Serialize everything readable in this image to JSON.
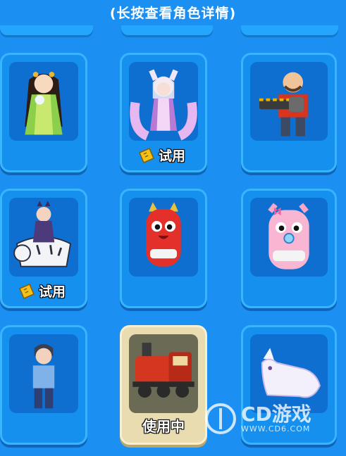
{
  "hint": "(长按查看角色详情)",
  "cards": [
    {
      "character": "green-robed girl",
      "icon": "girl-green-dress"
    },
    {
      "character": "nine-tailed fox girl",
      "badge": "试用",
      "icon": "fox-girl"
    },
    {
      "character": "chainsaw man",
      "icon": "chainsaw-man"
    },
    {
      "character": "cat girl on white tiger",
      "badge": "试用",
      "icon": "tiger-rider"
    },
    {
      "character": "red monster",
      "icon": "red-monster"
    },
    {
      "character": "pink baby monster",
      "icon": "pink-baby"
    },
    {
      "character": "boy",
      "icon": "boy"
    },
    {
      "character": "red train",
      "status": "使用中",
      "icon": "train",
      "selected": true
    },
    {
      "character": "white fox",
      "icon": "white-fox"
    }
  ],
  "watermark": {
    "brand": "CD游戏",
    "url": "WWW.CD6.COM"
  }
}
